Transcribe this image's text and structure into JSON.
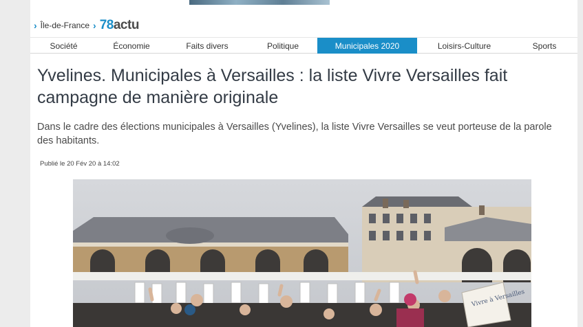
{
  "breadcrumb": {
    "region": "Île-de-France",
    "site_name_number": "78",
    "site_name_suffix": "actu"
  },
  "nav": {
    "items": [
      {
        "label": "Société"
      },
      {
        "label": "Économie"
      },
      {
        "label": "Faits divers"
      },
      {
        "label": "Politique"
      },
      {
        "label": "Municipales 2020",
        "active": true
      },
      {
        "label": "Loisirs-Culture"
      },
      {
        "label": "Sports"
      }
    ]
  },
  "article": {
    "title": "Yvelines. Municipales à Versailles : la liste Vivre Versailles fait campagne de manière originale",
    "lede": "Dans le cadre des élections municipales à Versailles (Yvelines), la liste Vivre Versailles se veut porteuse de la parole des habitants.",
    "published": "Publié le 20 Fév 20 à 14:02",
    "sign_text": "Vivre à Versailles"
  },
  "colors": {
    "accent": "#1a8ec8",
    "title": "#333b45"
  }
}
